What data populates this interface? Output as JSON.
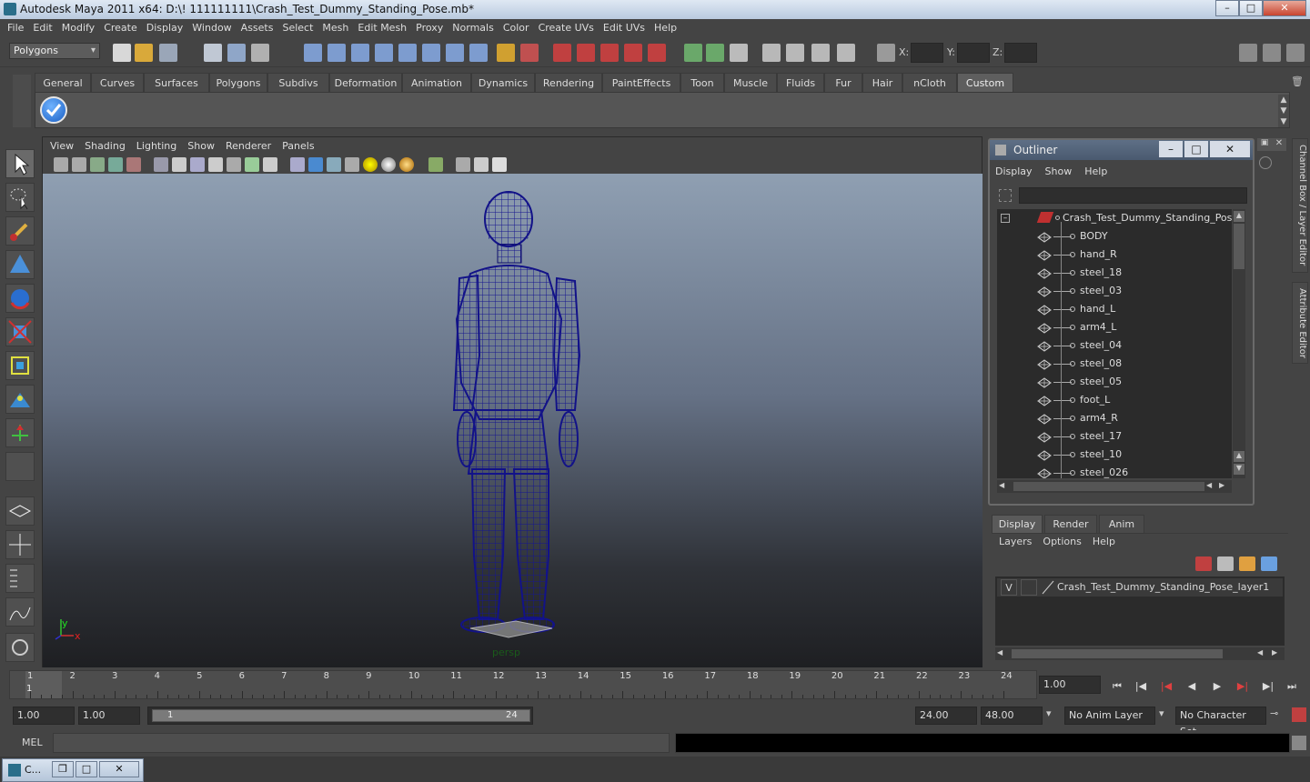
{
  "window": {
    "title": "Autodesk Maya 2011 x64: D:\\! 111111111\\Crash_Test_Dummy_Standing_Pose.mb*",
    "minimize": "–",
    "maximize": "□",
    "close": "✕"
  },
  "menubar": [
    "File",
    "Edit",
    "Modify",
    "Create",
    "Display",
    "Window",
    "Assets",
    "Select",
    "Mesh",
    "Edit Mesh",
    "Proxy",
    "Normals",
    "Color",
    "Create UVs",
    "Edit UVs",
    "Help"
  ],
  "statusline": {
    "mode": "Polygons",
    "x_label": "X:",
    "y_label": "Y:",
    "z_label": "Z:"
  },
  "shelf": {
    "tabs": [
      "General",
      "Curves",
      "Surfaces",
      "Polygons",
      "Subdivs",
      "Deformation",
      "Animation",
      "Dynamics",
      "Rendering",
      "PaintEffects",
      "Toon",
      "Muscle",
      "Fluids",
      "Fur",
      "Hair",
      "nCloth",
      "Custom"
    ],
    "active": "Custom"
  },
  "viewport": {
    "menu": [
      "View",
      "Shading",
      "Lighting",
      "Show",
      "Renderer",
      "Panels"
    ],
    "camera_label": "persp",
    "axis_y": "y",
    "axis_x": "x"
  },
  "outliner": {
    "title": "Outliner",
    "menu": [
      "Display",
      "Show",
      "Help"
    ],
    "root": "Crash_Test_Dummy_Standing_Pose",
    "items": [
      "BODY",
      "hand_R",
      "steel_18",
      "steel_03",
      "hand_L",
      "arm4_L",
      "steel_04",
      "steel_08",
      "steel_05",
      "foot_L",
      "arm4_R",
      "steel_17",
      "steel_10",
      "steel_026"
    ]
  },
  "sidetabs": {
    "channel_box": "Channel Box / Layer Editor",
    "attribute_editor": "Attribute Editor"
  },
  "layer_editor": {
    "tabs": [
      "Display",
      "Render",
      "Anim"
    ],
    "active": "Display",
    "menu": [
      "Layers",
      "Options",
      "Help"
    ],
    "layer": {
      "visible": "V",
      "name": "Crash_Test_Dummy_Standing_Pose_layer1"
    }
  },
  "timeline": {
    "ticks": [
      "1",
      "2",
      "3",
      "4",
      "5",
      "6",
      "7",
      "8",
      "9",
      "10",
      "11",
      "12",
      "13",
      "14",
      "15",
      "16",
      "17",
      "18",
      "19",
      "20",
      "21",
      "22",
      "23",
      "24"
    ],
    "current_frame_marker": "1",
    "current_time": "1.00"
  },
  "range": {
    "start": "1.00",
    "playback_start": "1.00",
    "slider_start": "1",
    "slider_end": "24",
    "playback_end": "24.00",
    "end": "48.00",
    "anim_layer": "No Anim Layer",
    "character_set": "No Character Set"
  },
  "command_line": {
    "label": "MEL"
  },
  "taskbar": {
    "item": "C..."
  },
  "colors": {
    "wireframe": "#14148a",
    "viewport_top": "#8f9fb2",
    "viewport_bottom": "#1e1f22",
    "outliner_title": "#4a5a70"
  }
}
